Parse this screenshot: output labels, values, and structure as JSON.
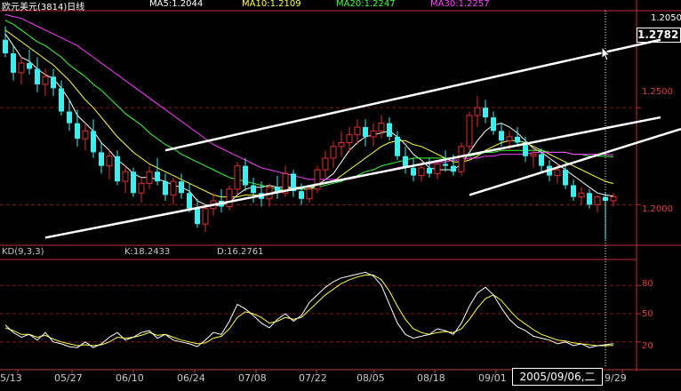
{
  "header": {
    "symbol": "欧元美元(3814)日线",
    "ma5": "MA5:1.2044",
    "ma10": "MA10:1.2109",
    "ma20": "MA20:1.2247",
    "ma30": "MA30:1.2257"
  },
  "indicator": {
    "name": "KD(9,3,3)",
    "k": "K:18.2433",
    "d": "D:16.2761"
  },
  "price_axis": {
    "top_tag": "1.2050",
    "current": "1.2782",
    "labels": [
      "1.2500",
      "1.2000"
    ]
  },
  "kd_axis": {
    "labels": [
      "80",
      "50",
      "20"
    ]
  },
  "x_axis": {
    "labels": [
      "5/13",
      "05/27",
      "06/10",
      "06/24",
      "07/08",
      "07/22",
      "08/05",
      "08/18",
      "09/01",
      "9/29"
    ]
  },
  "cursor_date": "2005/09/06,二",
  "colors": {
    "up": "#e03030",
    "down": "#3cf0f0",
    "ma5": "#ffffff",
    "ma10": "#ffff40",
    "ma20": "#40ff40",
    "ma30": "#ff40ff",
    "grid": "#8a1818",
    "axis": "#c03030",
    "trend": "#ffffff",
    "k": "#ffffff",
    "d": "#ffff40"
  },
  "chart_data": {
    "type": "candlestick",
    "price_range": [
      1.18,
      1.3
    ],
    "kd_range": [
      0,
      100
    ],
    "channel_lines": [
      {
        "from": [
          5,
          1.183
        ],
        "to": [
          81,
          1.245
        ]
      },
      {
        "from": [
          20,
          1.228
        ],
        "to": [
          81,
          1.285
        ]
      }
    ],
    "candles": [
      [
        1.285,
        1.292,
        1.276,
        1.278
      ],
      [
        1.278,
        1.282,
        1.264,
        1.268
      ],
      [
        1.268,
        1.276,
        1.262,
        1.273
      ],
      [
        1.273,
        1.28,
        1.267,
        1.27
      ],
      [
        1.27,
        1.276,
        1.258,
        1.262
      ],
      [
        1.262,
        1.27,
        1.256,
        1.266
      ],
      [
        1.266,
        1.27,
        1.256,
        1.26
      ],
      [
        1.26,
        1.264,
        1.246,
        1.248
      ],
      [
        1.248,
        1.254,
        1.238,
        1.242
      ],
      [
        1.242,
        1.249,
        1.23,
        1.234
      ],
      [
        1.234,
        1.242,
        1.228,
        1.238
      ],
      [
        1.238,
        1.244,
        1.224,
        1.227
      ],
      [
        1.227,
        1.232,
        1.216,
        1.22
      ],
      [
        1.22,
        1.228,
        1.213,
        1.225
      ],
      [
        1.225,
        1.228,
        1.21,
        1.212
      ],
      [
        1.212,
        1.22,
        1.206,
        1.217
      ],
      [
        1.217,
        1.219,
        1.204,
        1.206
      ],
      [
        1.206,
        1.214,
        1.201,
        1.211
      ],
      [
        1.211,
        1.22,
        1.208,
        1.217
      ],
      [
        1.217,
        1.224,
        1.21,
        1.212
      ],
      [
        1.212,
        1.216,
        1.202,
        1.205
      ],
      [
        1.205,
        1.214,
        1.2,
        1.212
      ],
      [
        1.212,
        1.216,
        1.203,
        1.206
      ],
      [
        1.206,
        1.211,
        1.196,
        1.198
      ],
      [
        1.198,
        1.203,
        1.188,
        1.19
      ],
      [
        1.19,
        1.2,
        1.186,
        1.198
      ],
      [
        1.198,
        1.206,
        1.194,
        1.202
      ],
      [
        1.202,
        1.208,
        1.196,
        1.199
      ],
      [
        1.199,
        1.21,
        1.197,
        1.208
      ],
      [
        1.208,
        1.222,
        1.205,
        1.22
      ],
      [
        1.22,
        1.224,
        1.207,
        1.21
      ],
      [
        1.21,
        1.214,
        1.201,
        1.206
      ],
      [
        1.206,
        1.212,
        1.199,
        1.203
      ],
      [
        1.203,
        1.211,
        1.199,
        1.209
      ],
      [
        1.209,
        1.215,
        1.203,
        1.206
      ],
      [
        1.206,
        1.22,
        1.204,
        1.216
      ],
      [
        1.216,
        1.218,
        1.204,
        1.207
      ],
      [
        1.207,
        1.211,
        1.2,
        1.203
      ],
      [
        1.203,
        1.21,
        1.201,
        1.208
      ],
      [
        1.208,
        1.22,
        1.206,
        1.218
      ],
      [
        1.218,
        1.228,
        1.214,
        1.224
      ],
      [
        1.224,
        1.233,
        1.219,
        1.23
      ],
      [
        1.23,
        1.238,
        1.225,
        1.232
      ],
      [
        1.232,
        1.24,
        1.227,
        1.236
      ],
      [
        1.236,
        1.244,
        1.231,
        1.24
      ],
      [
        1.24,
        1.244,
        1.23,
        1.235
      ],
      [
        1.235,
        1.242,
        1.23,
        1.238
      ],
      [
        1.238,
        1.246,
        1.234,
        1.242
      ],
      [
        1.242,
        1.245,
        1.233,
        1.235
      ],
      [
        1.235,
        1.238,
        1.223,
        1.225
      ],
      [
        1.225,
        1.23,
        1.216,
        1.219
      ],
      [
        1.219,
        1.224,
        1.212,
        1.215
      ],
      [
        1.215,
        1.222,
        1.212,
        1.219
      ],
      [
        1.219,
        1.224,
        1.214,
        1.216
      ],
      [
        1.216,
        1.223,
        1.213,
        1.221
      ],
      [
        1.221,
        1.228,
        1.217,
        1.22
      ],
      [
        1.22,
        1.226,
        1.215,
        1.217
      ],
      [
        1.217,
        1.232,
        1.215,
        1.23
      ],
      [
        1.23,
        1.248,
        1.228,
        1.246
      ],
      [
        1.246,
        1.256,
        1.24,
        1.25
      ],
      [
        1.25,
        1.254,
        1.242,
        1.245
      ],
      [
        1.245,
        1.248,
        1.236,
        1.238
      ],
      [
        1.238,
        1.242,
        1.23,
        1.233
      ],
      [
        1.233,
        1.238,
        1.228,
        1.235
      ],
      [
        1.235,
        1.24,
        1.23,
        1.232
      ],
      [
        1.232,
        1.235,
        1.222,
        1.225
      ],
      [
        1.225,
        1.229,
        1.219,
        1.226
      ],
      [
        1.226,
        1.229,
        1.217,
        1.22
      ],
      [
        1.22,
        1.223,
        1.212,
        1.215
      ],
      [
        1.215,
        1.221,
        1.211,
        1.218
      ],
      [
        1.218,
        1.222,
        1.208,
        1.21
      ],
      [
        1.21,
        1.213,
        1.202,
        1.204
      ],
      [
        1.204,
        1.209,
        1.2,
        1.206
      ],
      [
        1.206,
        1.208,
        1.198,
        1.2
      ],
      [
        1.2,
        1.205,
        1.196,
        1.204
      ],
      [
        1.204,
        1.206,
        1.182,
        1.202
      ],
      [
        1.202,
        1.206,
        1.199,
        1.204
      ]
    ],
    "series": [
      {
        "name": "MA5",
        "values": [
          1.288,
          1.282,
          1.276,
          1.274,
          1.27,
          1.267,
          1.265,
          1.26,
          1.254,
          1.246,
          1.242,
          1.238,
          1.232,
          1.228,
          1.223,
          1.22,
          1.216,
          1.214,
          1.214,
          1.213,
          1.212,
          1.21,
          1.209,
          1.207,
          1.202,
          1.2,
          1.199,
          1.2,
          1.201,
          1.205,
          1.208,
          1.209,
          1.209,
          1.21,
          1.209,
          1.209,
          1.209,
          1.208,
          1.208,
          1.21,
          1.213,
          1.216,
          1.222,
          1.228,
          1.232,
          1.235,
          1.236,
          1.237,
          1.238,
          1.235,
          1.231,
          1.226,
          1.223,
          1.219,
          1.218,
          1.218,
          1.218,
          1.221,
          1.227,
          1.233,
          1.238,
          1.241,
          1.242,
          1.24,
          1.237,
          1.233,
          1.229,
          1.227,
          1.224,
          1.221,
          1.218,
          1.215,
          1.212,
          1.209,
          1.206,
          1.205,
          1.2044
        ]
      },
      {
        "name": "MA10",
        "values": [
          1.29,
          1.287,
          1.284,
          1.281,
          1.278,
          1.275,
          1.272,
          1.268,
          1.264,
          1.259,
          1.254,
          1.25,
          1.245,
          1.24,
          1.235,
          1.231,
          1.227,
          1.224,
          1.221,
          1.219,
          1.217,
          1.215,
          1.213,
          1.211,
          1.209,
          1.207,
          1.205,
          1.204,
          1.204,
          1.204,
          1.205,
          1.205,
          1.205,
          1.206,
          1.207,
          1.208,
          1.209,
          1.209,
          1.209,
          1.21,
          1.211,
          1.212,
          1.215,
          1.218,
          1.221,
          1.224,
          1.227,
          1.23,
          1.232,
          1.233,
          1.233,
          1.231,
          1.23,
          1.228,
          1.226,
          1.224,
          1.222,
          1.222,
          1.223,
          1.225,
          1.228,
          1.23,
          1.232,
          1.233,
          1.233,
          1.232,
          1.23,
          1.228,
          1.226,
          1.224,
          1.222,
          1.22,
          1.218,
          1.216,
          1.214,
          1.212,
          1.2109
        ]
      },
      {
        "name": "MA20",
        "values": [
          1.295,
          1.293,
          1.29,
          1.287,
          1.284,
          1.282,
          1.279,
          1.276,
          1.272,
          1.269,
          1.266,
          1.262,
          1.259,
          1.255,
          1.251,
          1.247,
          1.244,
          1.241,
          1.237,
          1.234,
          1.231,
          1.229,
          1.226,
          1.224,
          1.222,
          1.22,
          1.218,
          1.216,
          1.214,
          1.213,
          1.212,
          1.211,
          1.21,
          1.209,
          1.208,
          1.208,
          1.208,
          1.208,
          1.208,
          1.209,
          1.21,
          1.211,
          1.212,
          1.214,
          1.215,
          1.217,
          1.218,
          1.22,
          1.221,
          1.222,
          1.223,
          1.224,
          1.224,
          1.224,
          1.224,
          1.224,
          1.224,
          1.225,
          1.225,
          1.226,
          1.227,
          1.227,
          1.228,
          1.228,
          1.228,
          1.228,
          1.228,
          1.228,
          1.227,
          1.227,
          1.227,
          1.226,
          1.226,
          1.225,
          1.225,
          1.225,
          1.2247
        ]
      },
      {
        "name": "MA30",
        "values": [
          1.298,
          1.297,
          1.296,
          1.294,
          1.292,
          1.29,
          1.288,
          1.286,
          1.284,
          1.282,
          1.279,
          1.276,
          1.273,
          1.27,
          1.267,
          1.264,
          1.261,
          1.258,
          1.255,
          1.252,
          1.249,
          1.246,
          1.243,
          1.24,
          1.237,
          1.234,
          1.231,
          1.229,
          1.227,
          1.225,
          1.223,
          1.221,
          1.219,
          1.218,
          1.217,
          1.216,
          1.215,
          1.214,
          1.213,
          1.213,
          1.213,
          1.213,
          1.213,
          1.213,
          1.214,
          1.215,
          1.216,
          1.217,
          1.218,
          1.219,
          1.22,
          1.22,
          1.221,
          1.221,
          1.222,
          1.222,
          1.223,
          1.223,
          1.224,
          1.224,
          1.225,
          1.225,
          1.226,
          1.226,
          1.226,
          1.226,
          1.227,
          1.227,
          1.227,
          1.227,
          1.227,
          1.226,
          1.226,
          1.226,
          1.226,
          1.226,
          1.2257
        ]
      },
      {
        "name": "K",
        "values": [
          38,
          30,
          25,
          28,
          22,
          30,
          20,
          18,
          15,
          14,
          20,
          14,
          18,
          25,
          30,
          22,
          25,
          30,
          32,
          24,
          28,
          22,
          20,
          18,
          15,
          22,
          30,
          28,
          42,
          60,
          55,
          48,
          40,
          35,
          44,
          50,
          42,
          48,
          62,
          70,
          78,
          84,
          88,
          90,
          92,
          94,
          90,
          80,
          60,
          40,
          28,
          24,
          26,
          28,
          34,
          32,
          28,
          40,
          58,
          72,
          78,
          70,
          56,
          44,
          36,
          32,
          26,
          24,
          22,
          18,
          20,
          16,
          18,
          14,
          16,
          17,
          18.2433
        ]
      },
      {
        "name": "D",
        "values": [
          35,
          32,
          28,
          28,
          25,
          27,
          23,
          20,
          18,
          16,
          17,
          16,
          17,
          20,
          25,
          24,
          25,
          27,
          30,
          27,
          28,
          25,
          22,
          20,
          18,
          19,
          24,
          26,
          34,
          46,
          52,
          50,
          46,
          40,
          42,
          46,
          44,
          46,
          54,
          62,
          70,
          76,
          82,
          86,
          89,
          91,
          91,
          86,
          74,
          58,
          44,
          34,
          30,
          28,
          30,
          31,
          30,
          34,
          44,
          56,
          66,
          70,
          64,
          54,
          45,
          39,
          33,
          28,
          25,
          22,
          21,
          19,
          18,
          17,
          16,
          16,
          16.2761
        ]
      }
    ]
  }
}
